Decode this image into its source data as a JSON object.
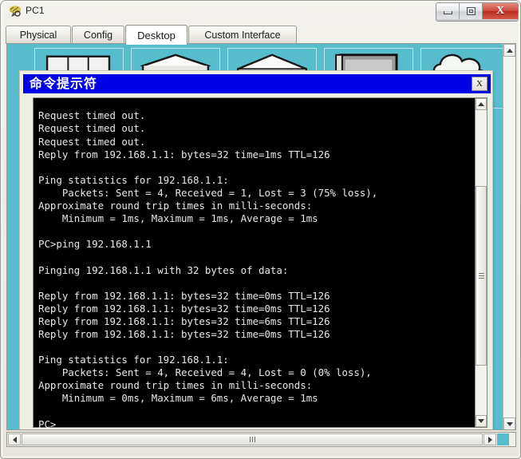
{
  "window": {
    "title": "PC1",
    "icon": "router-device-icon",
    "controls": {
      "minimize": "minimize-icon",
      "maximize": "maximize-icon",
      "close": "X"
    }
  },
  "tabs": [
    {
      "label": "Physical",
      "active": false
    },
    {
      "label": "Config",
      "active": false
    },
    {
      "label": "Desktop",
      "active": true
    },
    {
      "label": "Custom Interface",
      "active": false
    }
  ],
  "desktop": {
    "background_color": "#57bdcd",
    "icons": [
      {
        "name": "desktop-icon-1"
      },
      {
        "name": "desktop-icon-2"
      },
      {
        "name": "desktop-icon-3"
      },
      {
        "name": "desktop-icon-4"
      },
      {
        "name": "desktop-icon-5"
      }
    ]
  },
  "command_prompt": {
    "title": "命令提示符",
    "titlebar_color": "#0000e4",
    "close_label": "X",
    "terminal": {
      "background_color": "#000000",
      "text_color": "#e8e8e8",
      "content": "Request timed out.\nRequest timed out.\nRequest timed out.\nReply from 192.168.1.1: bytes=32 time=1ms TTL=126\n\nPing statistics for 192.168.1.1:\n    Packets: Sent = 4, Received = 1, Lost = 3 (75% loss),\nApproximate round trip times in milli-seconds:\n    Minimum = 1ms, Maximum = 1ms, Average = 1ms\n\nPC>ping 192.168.1.1\n\nPinging 192.168.1.1 with 32 bytes of data:\n\nReply from 192.168.1.1: bytes=32 time=0ms TTL=126\nReply from 192.168.1.1: bytes=32 time=0ms TTL=126\nReply from 192.168.1.1: bytes=32 time=6ms TTL=126\nReply from 192.168.1.1: bytes=32 time=0ms TTL=126\n\nPing statistics for 192.168.1.1:\n    Packets: Sent = 4, Received = 4, Lost = 0 (0% loss),\nApproximate round trip times in milli-seconds:\n    Minimum = 0ms, Maximum = 6ms, Average = 1ms\n\nPC>"
    }
  },
  "scrollbars": {
    "desktop_vertical": {
      "up": "scroll-up-arrow",
      "down": "scroll-down-arrow"
    },
    "desktop_horizontal": {
      "left": "scroll-left-arrow",
      "right": "scroll-right-arrow"
    },
    "terminal_vertical": {
      "up": "scroll-up-arrow",
      "down": "scroll-down-arrow"
    }
  }
}
